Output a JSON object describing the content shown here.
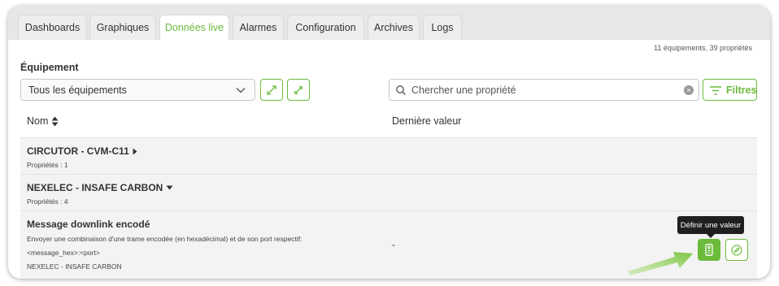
{
  "tabs": [
    {
      "label": "Dashboards",
      "active": false
    },
    {
      "label": "Graphiques",
      "active": false
    },
    {
      "label": "Données live",
      "active": true
    },
    {
      "label": "Alarmes",
      "active": false
    },
    {
      "label": "Configuration",
      "active": false
    },
    {
      "label": "Archives",
      "active": false
    },
    {
      "label": "Logs",
      "active": false
    }
  ],
  "summary": "11 équipements, 39 propriétés",
  "equipment": {
    "label": "Équipement",
    "selected": "Tous les équipements"
  },
  "search": {
    "placeholder": "Chercher une propriété",
    "value": ""
  },
  "filters_label": "Filtres",
  "table": {
    "col_name": "Nom",
    "col_last_value": "Dernière valeur"
  },
  "groups": [
    {
      "name": "CIRCUTOR - CVM-C11",
      "props": "Propriétés : 1",
      "expanded": false
    },
    {
      "name": "NEXELEC - INSAFE CARBON",
      "props": "Propriétés : 4",
      "expanded": true
    }
  ],
  "property": {
    "name": "Message downlink encodé",
    "desc_line1": "Envoyer une combinaison d'une trame encodée (en hexadécimal) et de son port respectif:",
    "desc_line2": "<message_hex>:<port>",
    "device": "NEXELEC - INSAFE CARBON",
    "last_value": "-"
  },
  "tooltip": "Définir une valeur",
  "colors": {
    "accent": "#6cbb3c",
    "tab_bg": "#e7e7e7",
    "row_bg": "#f3f3f3",
    "tooltip_bg": "#1f1f1f"
  },
  "icons": {
    "expand": "expand-arrows-icon",
    "collapse": "collapse-arrows-icon",
    "search": "search-icon",
    "clear": "clear-icon",
    "filters": "filter-lines-icon",
    "sort": "sort-icon",
    "set_value": "remote-control-icon",
    "edit": "edit-icon"
  }
}
